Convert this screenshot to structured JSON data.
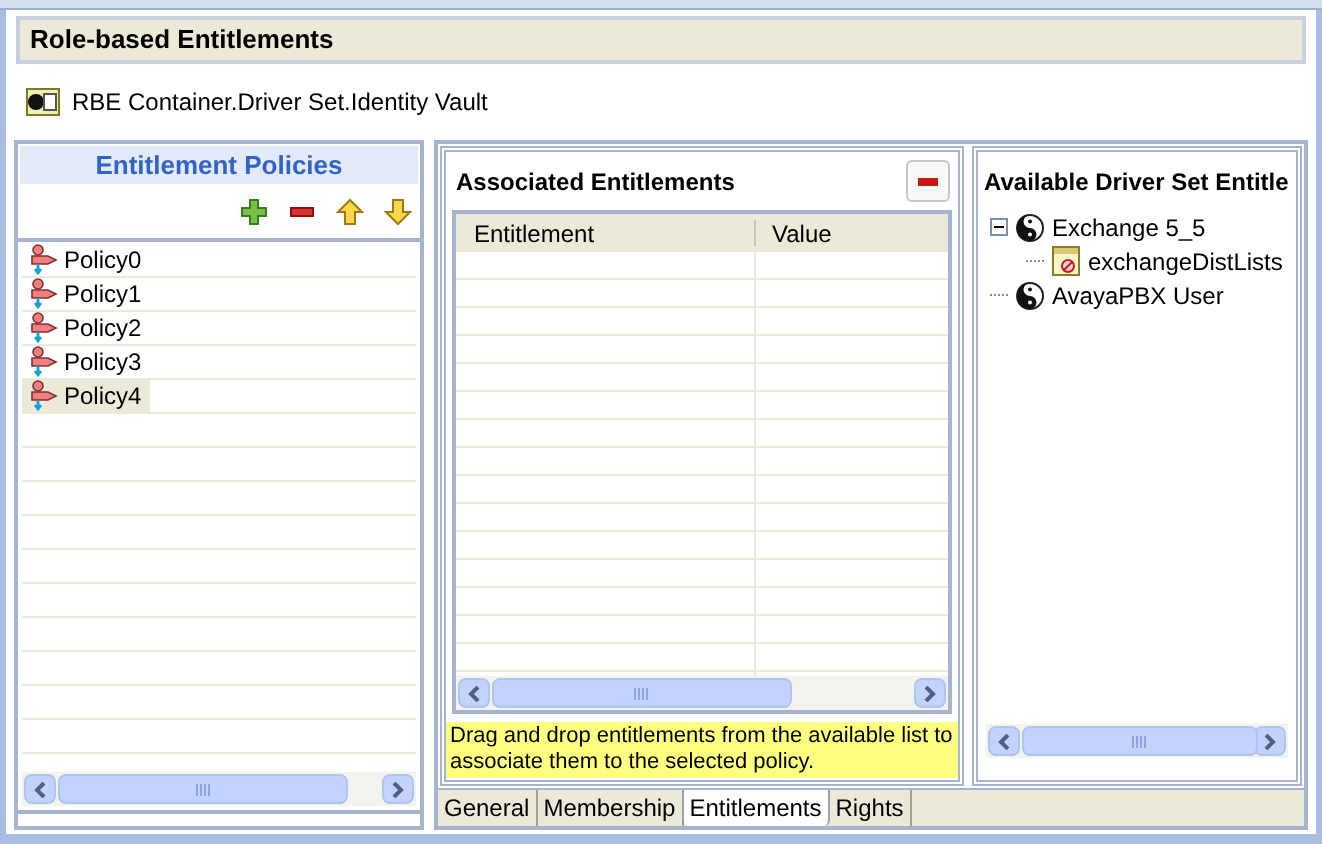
{
  "header": {
    "title": "Role-based Entitlements"
  },
  "path": "RBE Container.Driver Set.Identity Vault",
  "policies": {
    "title": "Entitlement Policies",
    "items": [
      {
        "label": "Policy0",
        "selected": false
      },
      {
        "label": "Policy1",
        "selected": false
      },
      {
        "label": "Policy2",
        "selected": false
      },
      {
        "label": "Policy3",
        "selected": false
      },
      {
        "label": "Policy4",
        "selected": true
      }
    ]
  },
  "associated": {
    "title": "Associated Entitlements",
    "columns": [
      "Entitlement",
      "Value"
    ],
    "note": "Drag and drop entitlements from the available list to associate them to the selected policy."
  },
  "available": {
    "title": "Available Driver Set Entitle",
    "tree": [
      {
        "label": "Exchange 5_5",
        "kind": "driver",
        "expanded": true,
        "children": [
          {
            "label": "exchangeDistLists",
            "kind": "entitlement"
          }
        ]
      },
      {
        "label": "AvayaPBX User",
        "kind": "driver"
      }
    ]
  },
  "tabs": [
    {
      "label": "General",
      "selected": false
    },
    {
      "label": "Membership",
      "selected": false
    },
    {
      "label": "Entitlements",
      "selected": true
    },
    {
      "label": "Rights",
      "selected": false
    }
  ]
}
